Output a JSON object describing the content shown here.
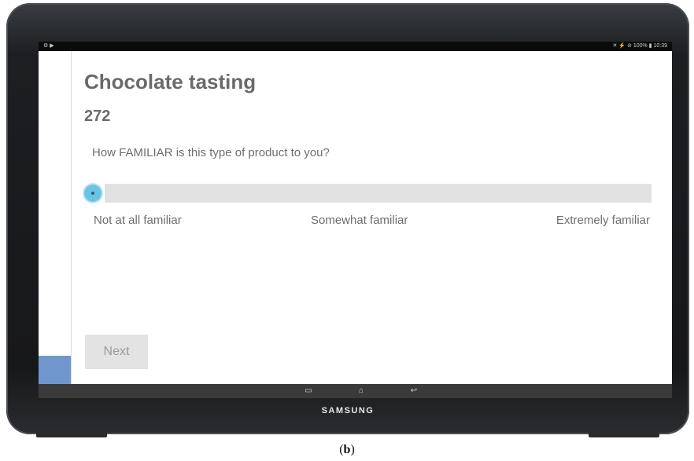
{
  "statusbar": {
    "left": "⚙ ▶",
    "right": "✕ ⚡ ⊘ 100% ▮ 10:39"
  },
  "survey": {
    "title": "Chocolate tasting",
    "sample_code": "272",
    "question": "How FAMILIAR is this type of product to you?",
    "slider": {
      "value": 0
    },
    "scale_labels": [
      "Not at all familiar",
      "Somewhat familiar",
      "Extremely   familiar"
    ],
    "next_label": "Next"
  },
  "navbar": {
    "recent_icon": "▭",
    "home_icon": "⌂",
    "back_icon": "↩"
  },
  "device": {
    "brand": "SAMSUNG"
  },
  "caption": {
    "prefix": "(",
    "letter": "b",
    "suffix": ")"
  },
  "colors": {
    "sidebar_accent": "#7196cd",
    "slider_thumb": "#6cc4e4",
    "track": "#e1e1e1"
  }
}
